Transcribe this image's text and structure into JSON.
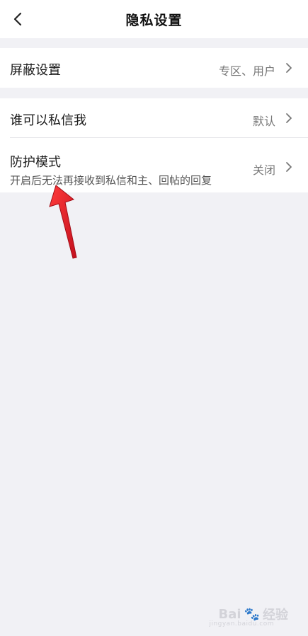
{
  "header": {
    "title": "隐私设置"
  },
  "rows": {
    "block": {
      "label": "屏蔽设置",
      "value": "专区、用户"
    },
    "dm": {
      "label": "谁可以私信我",
      "value": "默认"
    },
    "protect": {
      "label": "防护模式",
      "description": "开启后无法再接收到私信和主、回帖的回复",
      "value": "关闭"
    }
  },
  "watermark": {
    "brand": "Bai",
    "suffix": "经验",
    "url": "jingyan.baidu.com"
  },
  "colors": {
    "background": "#f1f1f5",
    "card": "#ffffff",
    "annotation_arrow": "#e8192c"
  }
}
